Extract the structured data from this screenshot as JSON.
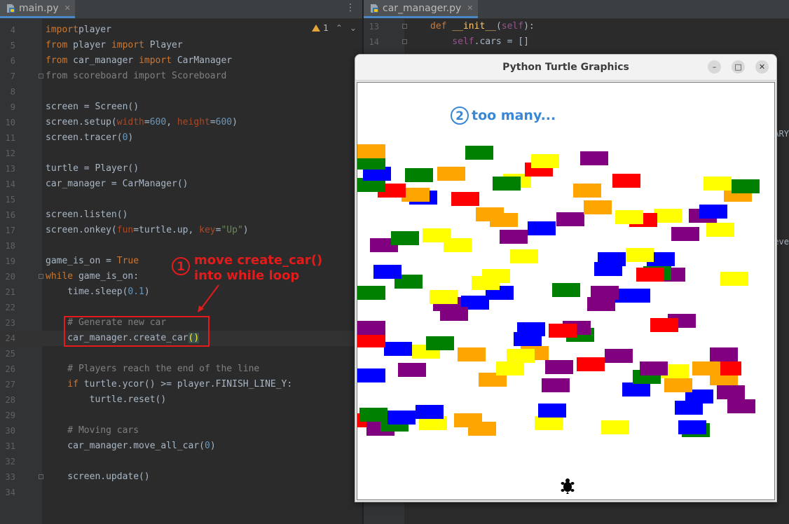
{
  "left_editor": {
    "tab_label": "main.py",
    "warning_count": "1",
    "lines": [
      {
        "n": "4",
        "segs": [
          [
            "kw",
            "import"
          ],
          [
            "",
            "player"
          ]
        ]
      },
      {
        "n": "5",
        "segs": [
          [
            "kw",
            "from"
          ],
          [
            "",
            " player "
          ],
          [
            "kw",
            "import"
          ],
          [
            "",
            " Player"
          ]
        ]
      },
      {
        "n": "6",
        "segs": [
          [
            "kw",
            "from"
          ],
          [
            "",
            " car_manager "
          ],
          [
            "kw",
            "import"
          ],
          [
            "",
            " CarManager"
          ]
        ]
      },
      {
        "n": "7",
        "segs": [
          [
            "cmt",
            "from scoreboard import Scoreboard"
          ]
        ]
      },
      {
        "n": "8",
        "segs": []
      },
      {
        "n": "9",
        "segs": [
          [
            "",
            "screen = Screen()"
          ]
        ]
      },
      {
        "n": "10",
        "segs": [
          [
            "",
            "screen.setup("
          ],
          [
            "param",
            "width"
          ],
          [
            "",
            "="
          ],
          [
            "num",
            "600"
          ],
          [
            "",
            ", "
          ],
          [
            "param",
            "height"
          ],
          [
            "",
            "="
          ],
          [
            "num",
            "600"
          ],
          [
            "",
            ")"
          ]
        ]
      },
      {
        "n": "11",
        "segs": [
          [
            "",
            "screen.tracer("
          ],
          [
            "num",
            "0"
          ],
          [
            "",
            ")"
          ]
        ]
      },
      {
        "n": "12",
        "segs": []
      },
      {
        "n": "13",
        "segs": [
          [
            "",
            "turtle = Player()"
          ]
        ]
      },
      {
        "n": "14",
        "segs": [
          [
            "",
            "car_manager = CarManager()"
          ]
        ]
      },
      {
        "n": "15",
        "segs": []
      },
      {
        "n": "16",
        "segs": [
          [
            "",
            "screen.listen()"
          ]
        ]
      },
      {
        "n": "17",
        "segs": [
          [
            "",
            "screen.onkey("
          ],
          [
            "param",
            "fun"
          ],
          [
            "",
            "=turtle.up, "
          ],
          [
            "param",
            "key"
          ],
          [
            "",
            "="
          ],
          [
            "str",
            "\"Up\""
          ],
          [
            "",
            ")"
          ]
        ]
      },
      {
        "n": "18",
        "segs": []
      },
      {
        "n": "19",
        "segs": [
          [
            "",
            "game_is_on = "
          ],
          [
            "kw",
            "True"
          ]
        ]
      },
      {
        "n": "20",
        "segs": [
          [
            "kw",
            "while"
          ],
          [
            "",
            " game_is_on:"
          ]
        ]
      },
      {
        "n": "21",
        "segs": [
          [
            "",
            "    time.sleep("
          ],
          [
            "num",
            "0.1"
          ],
          [
            "",
            ")"
          ]
        ]
      },
      {
        "n": "22",
        "segs": []
      },
      {
        "n": "23",
        "segs": [
          [
            "cmt",
            "    # Generate new car"
          ]
        ]
      },
      {
        "n": "24",
        "segs": [
          [
            "",
            "    car_manager.create_car"
          ],
          [
            "paren-hl",
            "()"
          ]
        ],
        "current": true
      },
      {
        "n": "25",
        "segs": []
      },
      {
        "n": "26",
        "segs": [
          [
            "cmt",
            "    # Players reach the end of the line"
          ]
        ]
      },
      {
        "n": "27",
        "segs": [
          [
            "kw",
            "    if"
          ],
          [
            "",
            " turtle.ycor() >= player.FINISH_LINE_Y:"
          ]
        ]
      },
      {
        "n": "28",
        "segs": [
          [
            "",
            "        turtle.reset()"
          ]
        ]
      },
      {
        "n": "29",
        "segs": []
      },
      {
        "n": "30",
        "segs": [
          [
            "cmt",
            "    # Moving cars"
          ]
        ]
      },
      {
        "n": "31",
        "segs": [
          [
            "",
            "    car_manager.move_all_car("
          ],
          [
            "num",
            "0"
          ],
          [
            "",
            ")"
          ]
        ]
      },
      {
        "n": "32",
        "segs": []
      },
      {
        "n": "33",
        "segs": [
          [
            "",
            "    screen.update()"
          ]
        ]
      },
      {
        "n": "34",
        "segs": []
      }
    ]
  },
  "right_editor": {
    "tab_label": "car_manager.py",
    "lines": [
      {
        "n": "13",
        "segs": [
          [
            "kw",
            "def "
          ],
          [
            "fn",
            "__init__"
          ],
          [
            "",
            "("
          ],
          [
            "self",
            "self"
          ],
          [
            "",
            "):"
          ]
        ]
      },
      {
        "n": "14",
        "segs": [
          [
            "self",
            "    self"
          ],
          [
            "",
            ".cars = []"
          ]
        ]
      }
    ],
    "edge_fragments": [
      "ARY",
      "eve"
    ]
  },
  "annotation_1": {
    "number": "1",
    "text": "move create_car()\ninto while loop",
    "color": "#e41b1b"
  },
  "turtle_window": {
    "title": "Python Turtle Graphics",
    "minimize_label": "–",
    "maximize_label": "□",
    "close_label": "✕",
    "annotation_2": {
      "number": "2",
      "text": "too many...",
      "color": "#3a87d6"
    },
    "cars": [
      [
        "#FFA500",
        0,
        88
      ],
      [
        "#008000",
        0,
        104
      ],
      [
        "#0000FF",
        8,
        120
      ],
      [
        "#008000",
        0,
        136
      ],
      [
        "#008000",
        154,
        90
      ],
      [
        "#FFFF00",
        248,
        102
      ],
      [
        "#FF0000",
        239,
        114
      ],
      [
        "#800080",
        318,
        98
      ],
      [
        "#008000",
        68,
        122
      ],
      [
        "#FFA500",
        114,
        120
      ],
      [
        "#008000",
        193,
        134
      ],
      [
        "#FFFF00",
        208,
        130
      ],
      [
        "#FF0000",
        29,
        144
      ],
      [
        "#FFA500",
        63,
        150
      ],
      [
        "#0000FF",
        74,
        154
      ],
      [
        "#FF0000",
        134,
        156
      ],
      [
        "#FF0000",
        364,
        130
      ],
      [
        "#FFFF00",
        494,
        134
      ],
      [
        "#008000",
        534,
        138
      ],
      [
        "#FFA500",
        523,
        150
      ],
      [
        "#FFA500",
        308,
        144
      ],
      [
        "#FFA500",
        323,
        168
      ],
      [
        "#FFA500",
        169,
        178
      ],
      [
        "#FFA500",
        189,
        186
      ],
      [
        "#800080",
        284,
        185
      ],
      [
        "#FFFF00",
        368,
        182
      ],
      [
        "#FF0000",
        388,
        186
      ],
      [
        "#FFFF00",
        423,
        180
      ],
      [
        "#0000FF",
        488,
        174
      ],
      [
        "#800080",
        473,
        180
      ],
      [
        "#FFFF00",
        498,
        200
      ],
      [
        "#800080",
        448,
        206
      ],
      [
        "#0000FF",
        243,
        198
      ],
      [
        "#800080",
        203,
        210
      ],
      [
        "#008000",
        48,
        212
      ],
      [
        "#800080",
        18,
        222
      ],
      [
        "#FFFF00",
        93,
        208
      ],
      [
        "#FFFF00",
        123,
        222
      ],
      [
        "#FFFF00",
        218,
        238
      ],
      [
        "#FFFF00",
        383,
        236
      ],
      [
        "#0000FF",
        343,
        242
      ],
      [
        "#0000FF",
        338,
        256
      ],
      [
        "#0000FF",
        413,
        242
      ],
      [
        "#FF0000",
        398,
        264
      ],
      [
        "#008000",
        408,
        262
      ],
      [
        "#800080",
        428,
        264
      ],
      [
        "#0000FF",
        23,
        260
      ],
      [
        "#008000",
        53,
        274
      ],
      [
        "#FFFF00",
        178,
        266
      ],
      [
        "#FFFF00",
        163,
        276
      ],
      [
        "#FFFF00",
        518,
        270
      ],
      [
        "#008000",
        0,
        290
      ],
      [
        "#FFFF00",
        103,
        296
      ],
      [
        "#800080",
        108,
        306
      ],
      [
        "#800080",
        118,
        320
      ],
      [
        "#0000FF",
        148,
        304
      ],
      [
        "#0000FF",
        183,
        290
      ],
      [
        "#008000",
        278,
        286
      ],
      [
        "#800080",
        333,
        290
      ],
      [
        "#800080",
        328,
        306
      ],
      [
        "#0000FF",
        358,
        294
      ],
      [
        "#0000FF",
        378,
        294
      ],
      [
        "#FF0000",
        418,
        336
      ],
      [
        "#800080",
        443,
        330
      ],
      [
        "#800080",
        0,
        340
      ],
      [
        "#FF0000",
        0,
        358
      ],
      [
        "#0000FF",
        228,
        342
      ],
      [
        "#0000FF",
        223,
        356
      ],
      [
        "#FF0000",
        273,
        344
      ],
      [
        "#800080",
        293,
        340
      ],
      [
        "#008000",
        298,
        350
      ],
      [
        "#008000",
        98,
        362
      ],
      [
        "#0000FF",
        38,
        370
      ],
      [
        "#FFFF00",
        78,
        374
      ],
      [
        "#FFA500",
        143,
        378
      ],
      [
        "#FFFF00",
        213,
        380
      ],
      [
        "#FFFF00",
        198,
        398
      ],
      [
        "#FFA500",
        233,
        376
      ],
      [
        "#800080",
        268,
        396
      ],
      [
        "#FF0000",
        313,
        392
      ],
      [
        "#800080",
        353,
        380
      ],
      [
        "#800080",
        503,
        378
      ],
      [
        "#800080",
        403,
        398
      ],
      [
        "#FFFF00",
        433,
        402
      ],
      [
        "#008000",
        393,
        410
      ],
      [
        "#FFA500",
        478,
        398
      ],
      [
        "#FF0000",
        508,
        398
      ],
      [
        "#FFA500",
        503,
        412
      ],
      [
        "#FFA500",
        438,
        422
      ],
      [
        "#0000FF",
        378,
        428
      ],
      [
        "#800080",
        263,
        422
      ],
      [
        "#FFA500",
        173,
        414
      ],
      [
        "#800080",
        58,
        400
      ],
      [
        "#0000FF",
        0,
        408
      ],
      [
        "#0000FF",
        468,
        438
      ],
      [
        "#0000FF",
        453,
        454
      ],
      [
        "#800080",
        513,
        432
      ],
      [
        "#800080",
        528,
        452
      ],
      [
        "#008000",
        3,
        464
      ],
      [
        "#0000FF",
        43,
        468
      ],
      [
        "#008000",
        33,
        478
      ],
      [
        "#800080",
        13,
        484
      ],
      [
        "#0000FF",
        83,
        460
      ],
      [
        "#FFFF00",
        88,
        476
      ],
      [
        "#FFA500",
        138,
        472
      ],
      [
        "#FFA500",
        158,
        484
      ],
      [
        "#0000FF",
        258,
        458
      ],
      [
        "#FFFF00",
        253,
        476
      ],
      [
        "#FFFF00",
        348,
        482
      ],
      [
        "#0000FF",
        458,
        482
      ],
      [
        "#008000",
        463,
        486
      ],
      [
        "#FF0000",
        0,
        472
      ]
    ]
  }
}
